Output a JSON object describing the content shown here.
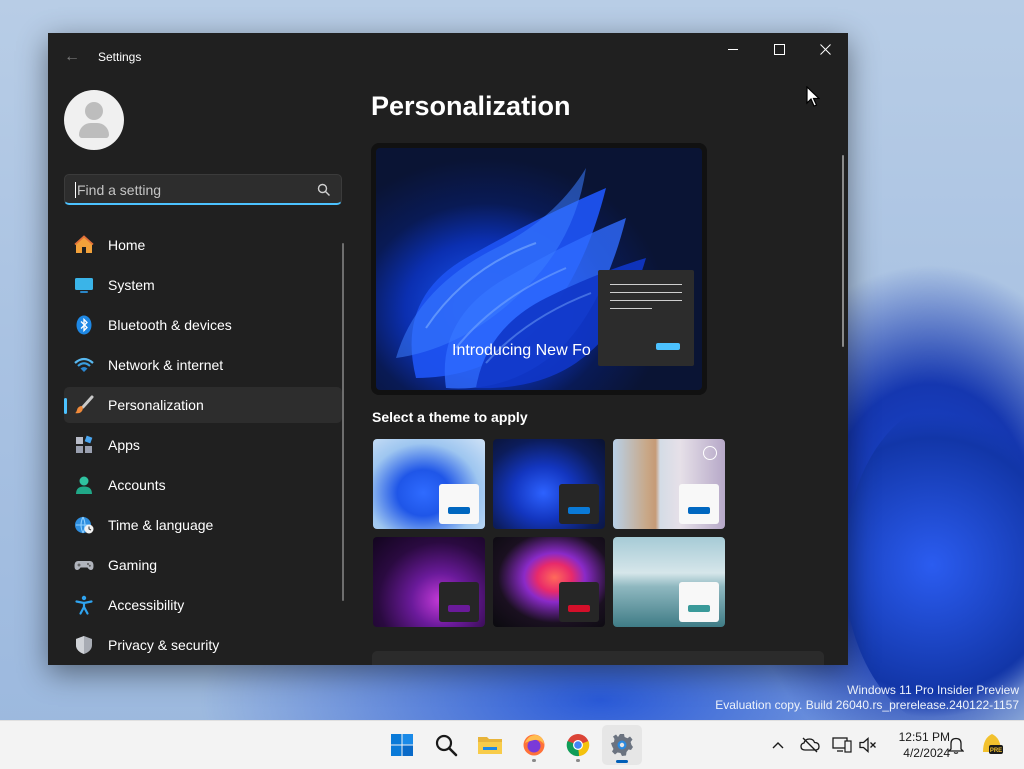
{
  "desktop": {
    "watermark_line1": "Windows 11 Pro Insider Preview",
    "watermark_line2": "Evaluation copy. Build 26040.rs_prerelease.240122-1157"
  },
  "window": {
    "title": "Settings",
    "minimize_icon": "minimize-icon",
    "maximize_icon": "maximize-icon",
    "close_icon": "close-icon"
  },
  "search": {
    "placeholder": "Find a setting",
    "icon": "search-icon",
    "accent": "#4cc2ff"
  },
  "sidebar": {
    "items": [
      {
        "label": "Home",
        "icon": "home-icon"
      },
      {
        "label": "System",
        "icon": "monitor-icon"
      },
      {
        "label": "Bluetooth & devices",
        "icon": "bluetooth-icon"
      },
      {
        "label": "Network & internet",
        "icon": "wifi-icon"
      },
      {
        "label": "Personalization",
        "icon": "paintbrush-icon",
        "active": true
      },
      {
        "label": "Apps",
        "icon": "apps-icon"
      },
      {
        "label": "Accounts",
        "icon": "account-icon"
      },
      {
        "label": "Time & language",
        "icon": "globe-clock-icon"
      },
      {
        "label": "Gaming",
        "icon": "gamepad-icon"
      },
      {
        "label": "Accessibility",
        "icon": "accessibility-icon"
      },
      {
        "label": "Privacy & security",
        "icon": "shield-icon"
      }
    ]
  },
  "main": {
    "title": "Personalization",
    "hero_text": "Introducing New Fo",
    "themes_heading": "Select a theme to apply",
    "themes": [
      {
        "name": "windows-light",
        "accent": "#0067c0"
      },
      {
        "name": "windows-dark",
        "accent": "#0067c0"
      },
      {
        "name": "windows-spotlight",
        "accent": "#0067c0",
        "selected": true
      },
      {
        "name": "glow",
        "accent": "#6a1a9a"
      },
      {
        "name": "captured-motion",
        "accent": "#d40f2a"
      },
      {
        "name": "flow",
        "accent": "#3a9a9a"
      }
    ]
  },
  "taskbar": {
    "apps": [
      "start-icon",
      "search-icon",
      "file-explorer-icon",
      "firefox-icon",
      "chrome-icon",
      "settings-icon"
    ],
    "time": "12:51 PM",
    "date": "4/2/2024"
  }
}
